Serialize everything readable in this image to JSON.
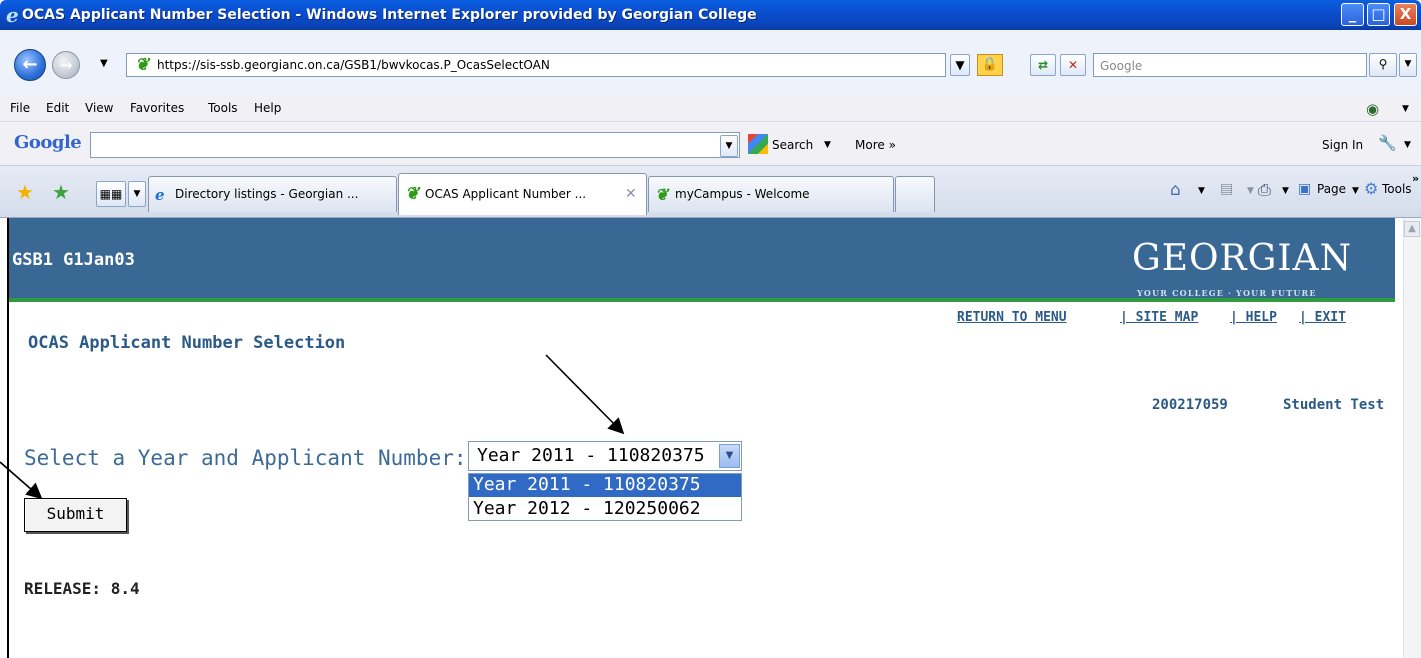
{
  "window": {
    "title": "OCAS Applicant Number Selection - Windows Internet Explorer provided by Georgian College",
    "controls": {
      "minimize": "_",
      "maximize": "□",
      "close": "X"
    }
  },
  "address_bar": {
    "url": "https://sis-ssb.georgianc.on.ca/GSB1/bwvkocas.P_OcasSelectOAN",
    "search_placeholder": "Google"
  },
  "menu": [
    "File",
    "Edit",
    "View",
    "Favorites",
    "Tools",
    "Help"
  ],
  "google_toolbar": {
    "logo": "Google",
    "search_label": "Search",
    "more_label": "More »",
    "sign_in_label": "Sign In"
  },
  "tabs": [
    {
      "label": "Directory listings - Georgian ...",
      "active": false
    },
    {
      "label": "OCAS Applicant Number ...",
      "active": true
    },
    {
      "label": "myCampus - Welcome",
      "active": false
    }
  ],
  "command_bar": {
    "page_label": "Page",
    "tools_label": "Tools"
  },
  "page": {
    "header_title": "GSB1 G1Jan03",
    "logo": "GEORGIAN",
    "logo_tagline": "YOUR COLLEGE · YOUR FUTURE",
    "links": {
      "return_to_menu": "RETURN TO MENU",
      "site_map": "| SITE MAP",
      "help": "| HELP",
      "exit": "| EXIT"
    },
    "title": "OCAS Applicant Number Selection",
    "student_id": "200217059",
    "student_name": "Student Test",
    "select_label": "Select a Year and Applicant Number:",
    "select_value": "Year 2011 - 110820375",
    "select_options": [
      {
        "label": "Year 2011 - 110820375",
        "selected": true
      },
      {
        "label": "Year 2012 - 120250062",
        "selected": false
      }
    ],
    "submit_label": "Submit",
    "release": "RELEASE: 8.4"
  }
}
